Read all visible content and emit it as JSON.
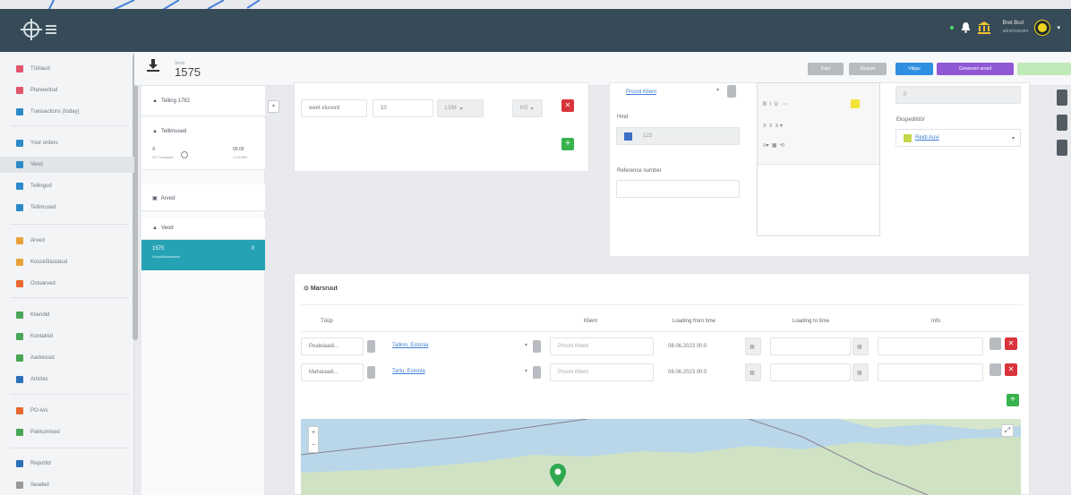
{
  "topbar": {
    "user_name": "Bret Bud",
    "user_role": "administrator"
  },
  "sidebar": {
    "items": [
      {
        "label": "Töölaud",
        "color": "#e0566d"
      },
      {
        "label": "Planeeritud",
        "color": "#e0566d"
      },
      {
        "label": "Transactions (today)",
        "color": "#2c8ac9"
      },
      {
        "label": "Your orders",
        "color": "#2c8ac9"
      },
      {
        "label": "Veod",
        "color": "#2c8ac9"
      },
      {
        "label": "Tellingud",
        "color": "#2c8ac9"
      },
      {
        "label": "Tellimused",
        "color": "#2c8ac9"
      },
      {
        "label": "Arved",
        "color": "#e7a33a"
      },
      {
        "label": "Kooskõlastatud",
        "color": "#e7a33a"
      },
      {
        "label": "Ostuarved",
        "color": "#e86a2e"
      },
      {
        "label": "Kliendid",
        "color": "#4aa657"
      },
      {
        "label": "Kontaktid",
        "color": "#4aa657"
      },
      {
        "label": "Aadressid",
        "color": "#4aa657"
      },
      {
        "label": "Articles",
        "color": "#2c6fb8"
      },
      {
        "label": "PO-ivis",
        "color": "#e86a2e"
      },
      {
        "label": "Pakkumised",
        "color": "#4aa657"
      },
      {
        "label": "Reportid",
        "color": "#2c6fb8"
      },
      {
        "label": "Seaded",
        "color": "#999999"
      }
    ]
  },
  "header": {
    "sup": "Vedu",
    "number": "1575",
    "buttons": [
      "Kopi",
      "Eksport",
      "Väljas",
      "Genereeri arved"
    ]
  },
  "col2": {
    "section1": "Telling 1782",
    "section2": "Tellimused",
    "s2_row_left": "X",
    "s2_row_sub": "SO Transport",
    "s2_row_right": "00.00",
    "s2_row_right_sub": "CLOSED",
    "section3": "Arved",
    "section4": "Veod",
    "active_title": "1575",
    "active_sub": "Kooskõlastamata",
    "active_count": "0"
  },
  "goods": {
    "name": "weet eluoord",
    "qty": "10",
    "unit": "LDM",
    "type": "KG"
  },
  "client": {
    "link": "Prooni Klient",
    "hind_label": "Hind",
    "hind_value": "123",
    "ref_label": "Reference number"
  },
  "right_form": {
    "field": "0",
    "exp_label": "Ekspeditöör",
    "exp_value": "Reidi Auvi"
  },
  "marsruut": {
    "title": "Marsruut",
    "columns": [
      "Tüüp",
      "Klient",
      "Loading from time",
      "Loading to time",
      "Info"
    ],
    "rows": [
      {
        "type": "Pealelaadi...",
        "address": "Tallinn, Estonia",
        "client": "Prooni Klient",
        "from": "08.06.2023 00:0"
      },
      {
        "type": "Mahalaadi...",
        "address": "Tartu, Estonia",
        "client": "Prooni Klient",
        "from": "08.06.2023 00:0"
      }
    ]
  }
}
